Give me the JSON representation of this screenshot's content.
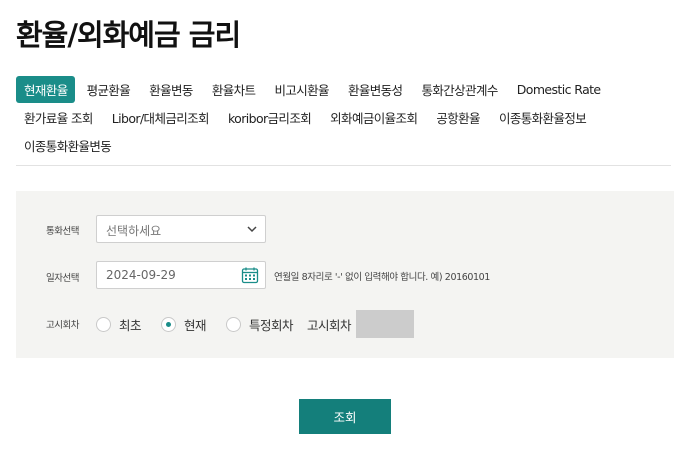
{
  "page": {
    "title": "환율/외화예금 금리"
  },
  "tabs": {
    "rows": [
      [
        {
          "label": "현재환율",
          "active": true
        },
        {
          "label": "평균환율"
        },
        {
          "label": "환율변동"
        },
        {
          "label": "환율차트"
        },
        {
          "label": "비고시환율"
        },
        {
          "label": "환율변동성"
        },
        {
          "label": "통화간상관계수"
        },
        {
          "label": "Domestic Rate"
        }
      ],
      [
        {
          "label": "환가료율 조회"
        },
        {
          "label": "Libor/대체금리조회"
        },
        {
          "label": "koribor금리조회"
        },
        {
          "label": "외화예금이율조회"
        },
        {
          "label": "공항환율"
        },
        {
          "label": "이종통화환율정보"
        }
      ],
      [
        {
          "label": "이종통화환율변동"
        }
      ]
    ]
  },
  "form": {
    "currency": {
      "label": "통화선택",
      "placeholder": "선택하세요"
    },
    "date": {
      "label": "일자선택",
      "value": "2024-09-29",
      "hint": "연월일 8자리로 '-' 없이 입력해야 합니다. 예) 20160101"
    },
    "round": {
      "label": "고시회차",
      "options": [
        {
          "label": "최초",
          "checked": false
        },
        {
          "label": "현재",
          "checked": true
        },
        {
          "label": "특정회차",
          "checked": false
        }
      ],
      "specific_label": "고시회차"
    },
    "submit_label": "조회"
  },
  "colors": {
    "accent": "#1a8d89",
    "panel": "#f4f4f2"
  }
}
